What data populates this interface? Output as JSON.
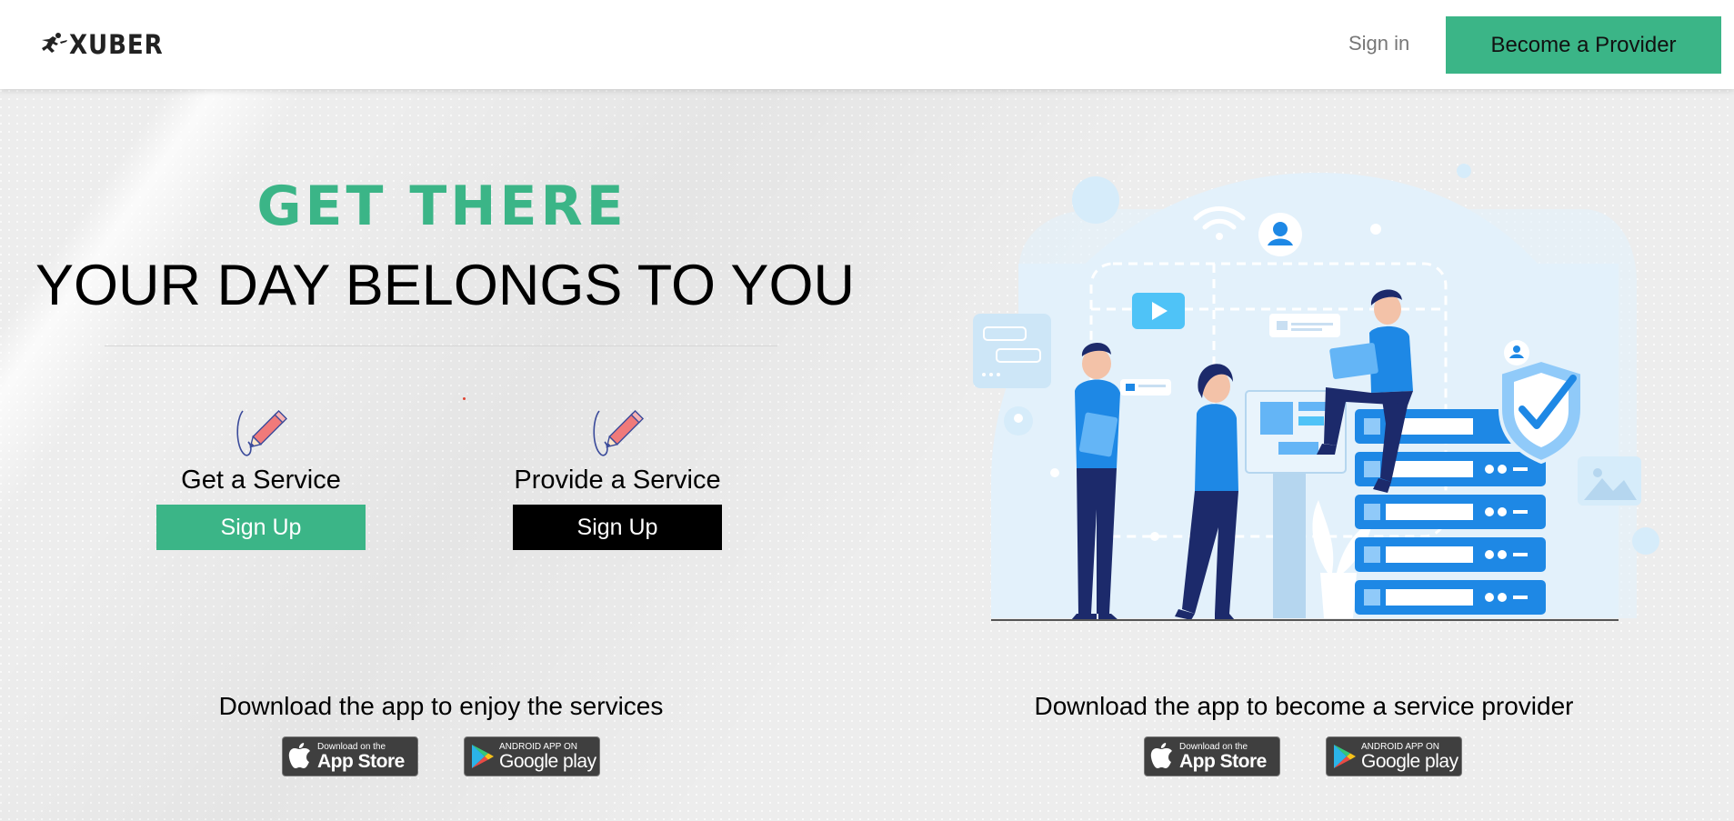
{
  "header": {
    "logo_text": "XUBER",
    "signin_label": "Sign in",
    "provider_button_label": "Become a Provider"
  },
  "hero": {
    "title": "GET THERE",
    "subtitle": "YOUR DAY BELONGS TO YOU"
  },
  "cards": [
    {
      "label": "Get a Service",
      "button_label": "Sign Up",
      "icon": "pencil-signature-icon"
    },
    {
      "label": "Provide a Service",
      "button_label": "Sign Up",
      "icon": "pencil-signature-icon"
    }
  ],
  "downloads": [
    {
      "text": "Download the app to enjoy the services",
      "app_store": {
        "small": "Download on the",
        "big": "App Store"
      },
      "google_play": {
        "small": "ANDROID APP ON",
        "big": "Google play"
      }
    },
    {
      "text": "Download the app to become a service provider",
      "app_store": {
        "small": "Download on the",
        "big": "App Store"
      },
      "google_play": {
        "small": "ANDROID APP ON",
        "big": "Google play"
      }
    }
  ],
  "colors": {
    "accent": "#3bb587",
    "dark_button": "#000000",
    "illustration_blue": "#1e88e5",
    "illustration_navy": "#1c2a6b"
  }
}
